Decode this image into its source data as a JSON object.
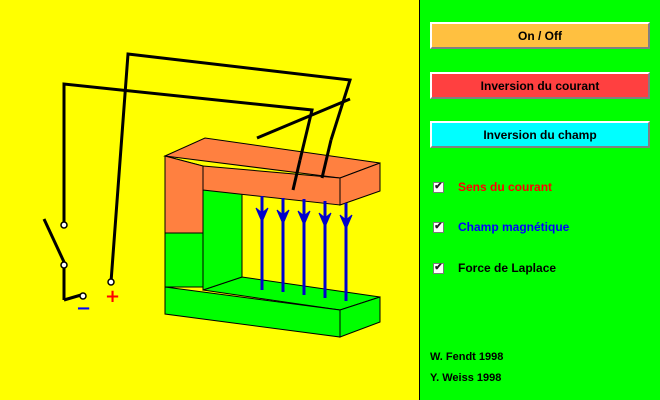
{
  "buttons": {
    "on_off": {
      "label": "On / Off",
      "color": "#ffc040"
    },
    "invert_current": {
      "label": "Inversion du courant",
      "color": "#ff4040"
    },
    "invert_field": {
      "label": "Inversion du champ",
      "color": "#00ffff"
    }
  },
  "options": [
    {
      "label": "Sens du courant",
      "checked": true,
      "color": "#ff0000"
    },
    {
      "label": "Champ magnétique",
      "checked": true,
      "color": "#0000ff"
    },
    {
      "label": "Force de Laplace",
      "checked": true,
      "color": "#000000"
    }
  ],
  "credits": {
    "line1": "W. Fendt 1998",
    "line2": "Y. Weiss 1998"
  },
  "terminals": {
    "minus": "−",
    "plus": "+"
  },
  "colors": {
    "canvas_bg": "#ffff00",
    "panel_bg": "#00ff00",
    "magnet_north": "#ff8040",
    "magnet_south": "#00ff00",
    "field_lines": "#0000cc",
    "minus": "#0000ff",
    "plus": "#ff0000"
  }
}
